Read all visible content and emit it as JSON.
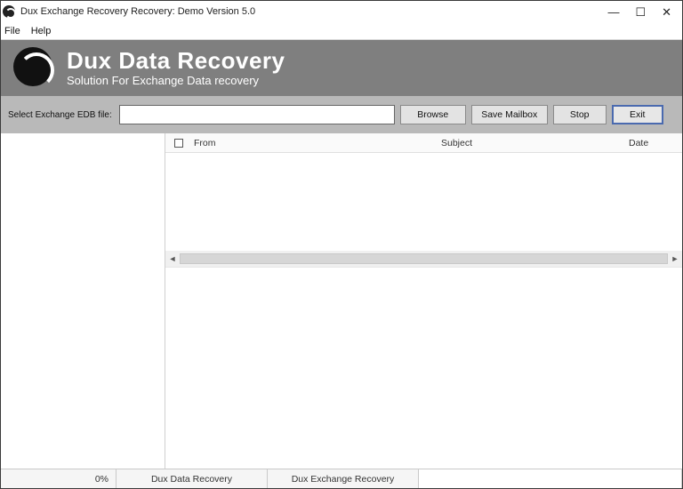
{
  "titlebar": {
    "title": "Dux Exchange Recovery Recovery: Demo Version 5.0"
  },
  "menu": {
    "file": "File",
    "help": "Help"
  },
  "banner": {
    "title": "Dux Data Recovery",
    "subtitle": "Solution For Exchange Data recovery"
  },
  "toolbar": {
    "label": "Select Exchange EDB file:",
    "path_value": "",
    "browse": "Browse",
    "save_mailbox": "Save Mailbox",
    "stop": "Stop",
    "exit": "Exit"
  },
  "list": {
    "columns": {
      "from": "From",
      "subject": "Subject",
      "date": "Date"
    }
  },
  "status": {
    "progress": "0%",
    "brand1": "Dux Data Recovery",
    "brand2": "Dux Exchange Recovery"
  }
}
